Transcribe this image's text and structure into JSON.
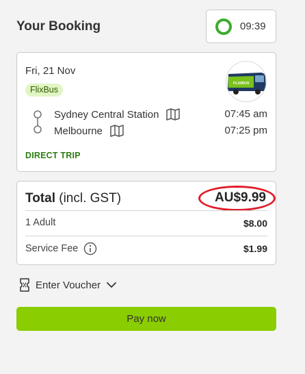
{
  "header": {
    "title": "Your Booking"
  },
  "timer": {
    "remaining": "09:39",
    "icon": "countdown-ring-icon",
    "progress_fraction": 0.97,
    "color": "#3dab2e"
  },
  "trip": {
    "date": "Fri, 21 Nov",
    "brand": "FlixBus",
    "logo_text": "FLIXBUS",
    "stops": [
      {
        "name": "Sydney Central Station",
        "time": "07:45 am",
        "icon": "map-icon"
      },
      {
        "name": "Melbourne",
        "time": "07:25 pm",
        "icon": "map-icon"
      }
    ],
    "trip_type": "DIRECT TRIP"
  },
  "price": {
    "total_label": "Total",
    "total_suffix": " (incl. GST)",
    "total_amount": "AU$9.99",
    "lines": [
      {
        "label": "1 Adult",
        "value": "$8.00"
      },
      {
        "label": "Service Fee",
        "value": "$1.99",
        "icon": "info-icon"
      }
    ]
  },
  "voucher": {
    "label": "Enter Voucher",
    "icon": "voucher-ticket-icon"
  },
  "pay": {
    "label": "Pay now"
  },
  "colors": {
    "accent": "#8acd00",
    "brand_green": "#2e7d12",
    "annotation_red": "#e11c2a"
  }
}
